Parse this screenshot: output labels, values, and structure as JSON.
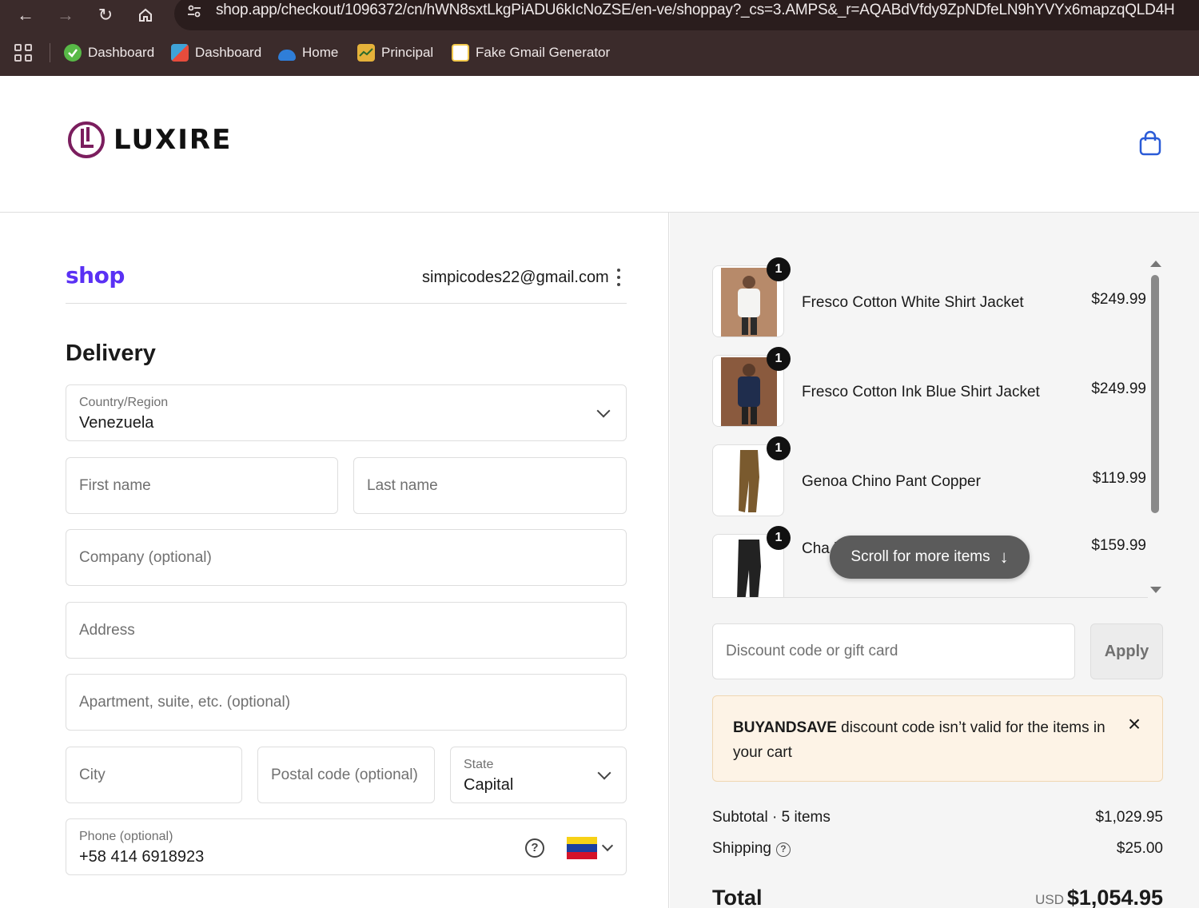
{
  "browser": {
    "url": "shop.app/checkout/1096372/cn/hWN8sxtLkgPiADU6kIcNoZSE/en-ve/shoppay?_cs=3.AMPS&_r=AQABdVfdy9ZpNDfeLN9hYVYx6mapzqQLD4H",
    "bookmarks": [
      {
        "label": "Dashboard",
        "icon": "green-check-icon",
        "color": "#58b947"
      },
      {
        "label": "Dashboard",
        "icon": "puzzle-icon",
        "color": "#3fa3d8"
      },
      {
        "label": "Home",
        "icon": "cloud-icon",
        "color": "#2f7ed8"
      },
      {
        "label": "Principal",
        "icon": "chart-icon",
        "color": "#e5b23a"
      },
      {
        "label": "Fake Gmail Generator",
        "icon": "envelope-icon",
        "color": "#f2c94c"
      }
    ]
  },
  "store": {
    "brand": "LUXIRE"
  },
  "checkout": {
    "shop_logo": "shop",
    "email": "simpicodes22@gmail.com",
    "delivery_title": "Delivery",
    "country": {
      "label": "Country/Region",
      "value": "Venezuela"
    },
    "first_name_placeholder": "First name",
    "last_name_placeholder": "Last name",
    "company_placeholder": "Company (optional)",
    "address_placeholder": "Address",
    "apartment_placeholder": "Apartment, suite, etc. (optional)",
    "city_placeholder": "City",
    "postal_placeholder": "Postal code (optional)",
    "state": {
      "label": "State",
      "value": "Capital"
    },
    "phone": {
      "label": "Phone (optional)",
      "value": "+58 414 6918923"
    },
    "flag_colors": [
      "#f7d116",
      "#1b3fa0",
      "#d4132a"
    ]
  },
  "summary": {
    "items": [
      {
        "name": "Fresco Cotton White Shirt Jacket",
        "price": "$249.99",
        "qty": "1"
      },
      {
        "name": "Fresco Cotton Ink Blue Shirt Jacket",
        "price": "$249.99",
        "qty": "1"
      },
      {
        "name": "Genoa Chino Pant Copper",
        "price": "$119.99",
        "qty": "1"
      },
      {
        "name": "Cha                            l High Waisted Pant",
        "price": "$159.99",
        "qty": "1"
      }
    ],
    "scroll_hint": "Scroll for more items",
    "discount_placeholder": "Discount code or gift card",
    "apply_label": "Apply",
    "alert": {
      "code": "BUYANDSAVE",
      "message": " discount code isn’t valid for the items in your cart"
    },
    "subtotal_label": "Subtotal · 5 items",
    "subtotal_value": "$1,029.95",
    "shipping_label": "Shipping",
    "shipping_value": "$25.00",
    "total_label": "Total",
    "currency": "USD",
    "total_value": "$1,054.95"
  }
}
